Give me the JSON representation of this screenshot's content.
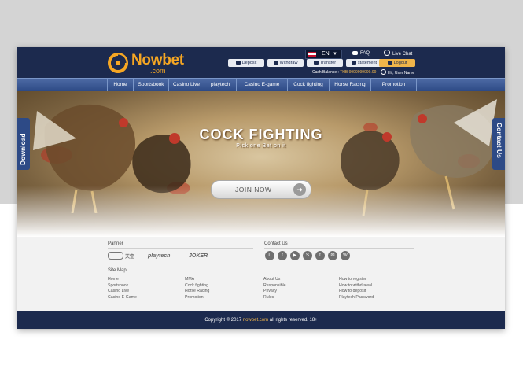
{
  "brand": {
    "name": "Nowbet",
    "domain": ".com"
  },
  "header": {
    "language": "EN",
    "faq": "FAQ",
    "live_chat": "Live Chat",
    "buttons": {
      "deposit": "Deposit",
      "withdraw": "Withdraw",
      "transfer": "Transfer",
      "statement": "statement",
      "logout": "Logout"
    },
    "cash_balance_label": "Cash Balance :",
    "cash_balance_value": "THB 9999999999.99",
    "greeting": "Hi , User Name"
  },
  "nav": {
    "items": [
      "Home",
      "Sportsbook",
      "Casino Live",
      "playtech",
      "Casino E-game",
      "Cock fighting",
      "Horse Racing",
      "Promotion"
    ]
  },
  "hero": {
    "title": "COCK FIGHTING",
    "subtitle": "Pick one  Bet on it",
    "cta": "JOIN NOW"
  },
  "side_tabs": {
    "left": "Download",
    "right": "Contact Us"
  },
  "footer": {
    "partner_heading": "Partner",
    "partners": [
      "天空",
      "playtech",
      "JOKER"
    ],
    "contact_heading": "Contact Us",
    "contact_icons": [
      "line-icon",
      "facebook-icon",
      "youtube-icon",
      "skype-icon",
      "twitter-icon",
      "email-icon",
      "wechat-icon"
    ],
    "sitemap_heading": "Site Map",
    "sitemap_cols": [
      [
        "Home",
        "Sportsbook",
        "Casino Live",
        "Casino E-Game"
      ],
      [
        "MMA",
        "Cock fighting",
        "Horse Racing",
        "Promotion"
      ],
      [
        "About Us",
        "Responsible",
        "Privacy",
        "Rules"
      ],
      [
        "How to register",
        "How to withdrawal",
        "How to deposit",
        "Playtech Password"
      ]
    ]
  },
  "copyright": {
    "prefix": "Copyright © 2017",
    "site": "nowbet.com",
    "suffix": "all rights reserved.  18+"
  },
  "colors": {
    "header_bg": "#1c2a4e",
    "nav_bg": "#2d4a86",
    "accent": "#f0b54a",
    "footer_bg": "#f2f2f2"
  }
}
